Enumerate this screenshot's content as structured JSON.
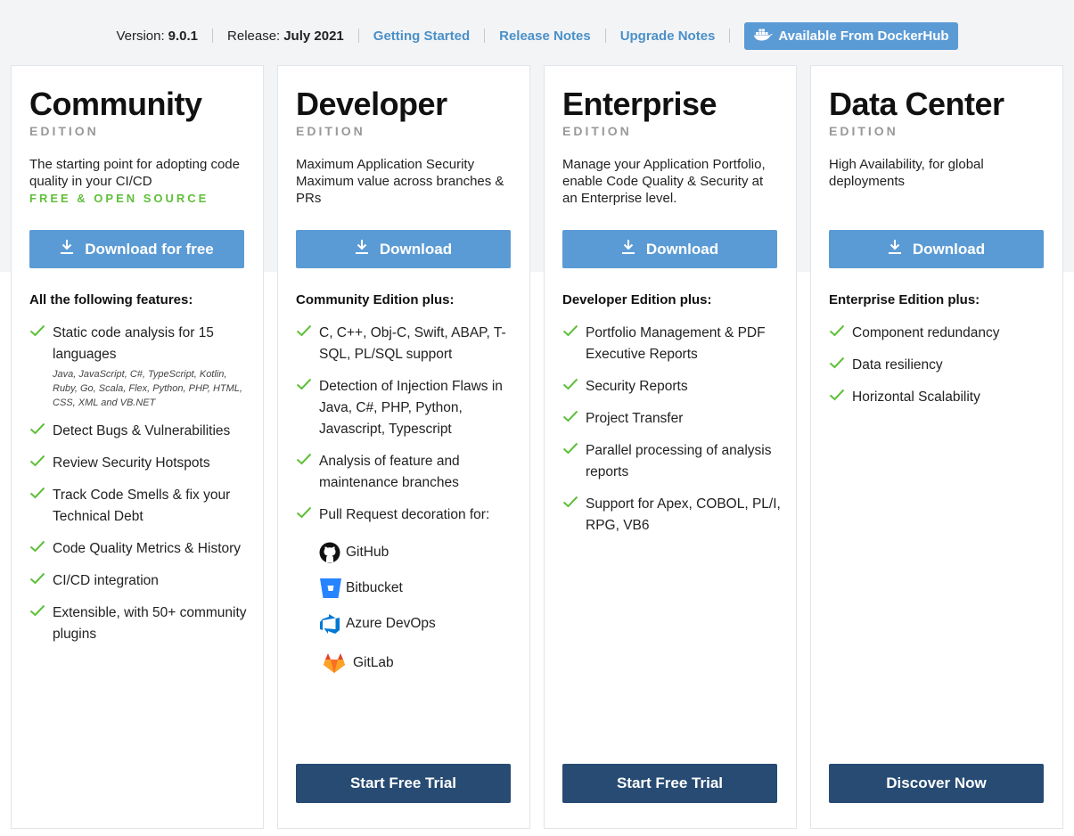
{
  "topbar": {
    "version_label": "Version:",
    "version_value": "9.0.1",
    "release_label": "Release:",
    "release_value": "July 2021",
    "links": [
      "Getting Started",
      "Release Notes",
      "Upgrade Notes"
    ],
    "docker_label": "Available From DockerHub"
  },
  "colors": {
    "primary": "#5b9bd5",
    "dark": "#274b73",
    "green": "#5fbf3a",
    "link": "#4a90c8"
  },
  "editions": [
    {
      "title": "Community",
      "subtitle": "EDITION",
      "description": "The starting point for adopting code quality in your CI/CD",
      "free_tag": "FREE & OPEN SOURCE",
      "download_label": "Download for free",
      "features_heading": "All the following features:",
      "features": [
        "Static code analysis for 15 languages",
        "Detect Bugs & Vulnerabilities",
        "Review Security Hotspots",
        "Track Code Smells & fix your Technical Debt",
        "Code Quality Metrics & History",
        "CI/CD integration",
        "Extensible, with 50+ community plugins"
      ],
      "languages_note": "Java, JavaScript, C#, TypeScript, Kotlin, Ruby, Go, Scala, Flex, Python, PHP, HTML, CSS, XML and VB.NET"
    },
    {
      "title": "Developer",
      "subtitle": "EDITION",
      "description": "Maximum Application Security Maximum value across branches & PRs",
      "download_label": "Download",
      "features_heading": "Community Edition plus:",
      "features": [
        "C, C++, Obj-C, Swift, ABAP, T-SQL, PL/SQL support",
        "Detection of Injection Flaws in Java, C#, PHP, Python, Javascript, Typescript",
        "Analysis of feature and maintenance branches",
        "Pull Request decoration for:"
      ],
      "providers": [
        "GitHub",
        "Bitbucket",
        "Azure DevOps",
        "GitLab"
      ],
      "cta_label": "Start Free Trial"
    },
    {
      "title": "Enterprise",
      "subtitle": "EDITION",
      "description": "Manage your Application Portfolio, enable Code Quality & Security at an Enterprise level.",
      "download_label": "Download",
      "features_heading": "Developer Edition plus:",
      "features": [
        "Portfolio Management & PDF Executive Reports",
        "Security Reports",
        "Project Transfer",
        "Parallel processing of analysis reports",
        "Support for Apex, COBOL, PL/I, RPG, VB6"
      ],
      "cta_label": "Start Free Trial"
    },
    {
      "title": "Data Center",
      "subtitle": "EDITION",
      "description": "High Availability, for global deployments",
      "download_label": "Download",
      "features_heading": "Enterprise Edition plus:",
      "features": [
        "Component redundancy",
        "Data resiliency",
        "Horizontal Scalability"
      ],
      "cta_label": "Discover Now"
    }
  ]
}
